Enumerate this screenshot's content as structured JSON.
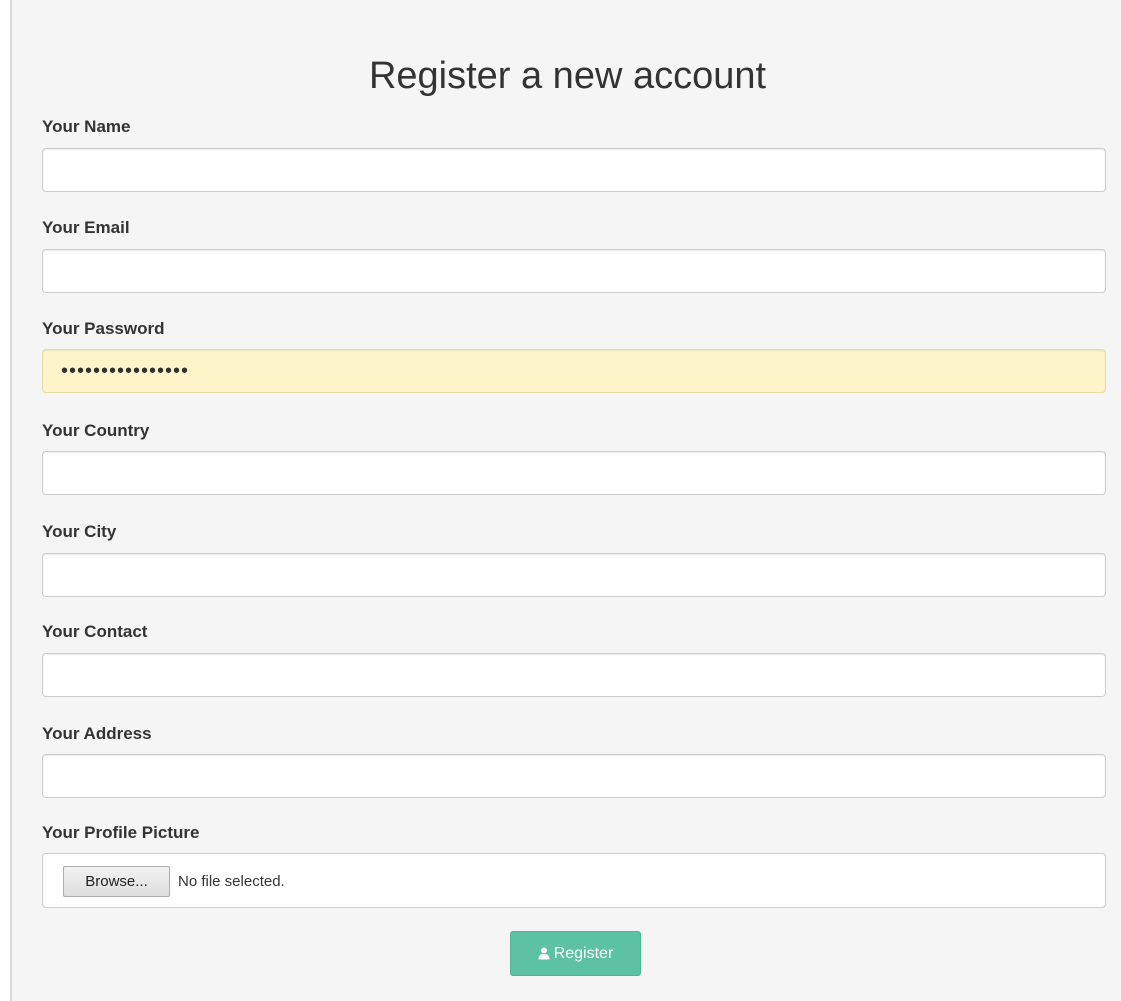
{
  "form": {
    "title": "Register a new account",
    "fields": [
      {
        "label": "Your Name",
        "value": "",
        "type": "text"
      },
      {
        "label": "Your Email",
        "value": "",
        "type": "email"
      },
      {
        "label": "Your Password",
        "value": "••••••••••••••••",
        "type": "password"
      },
      {
        "label": "Your Country",
        "value": "",
        "type": "text"
      },
      {
        "label": "Your City",
        "value": "",
        "type": "text"
      },
      {
        "label": "Your Contact",
        "value": "",
        "type": "text"
      },
      {
        "label": "Your Address",
        "value": "",
        "type": "text"
      }
    ],
    "profile_picture": {
      "label": "Your Profile Picture",
      "browse_label": "Browse...",
      "status": "No file selected."
    },
    "submit": {
      "label": "Register",
      "icon": "user-icon"
    }
  },
  "colors": {
    "page_background": "#f5f5f5",
    "autofill_background": "#fdf5c9",
    "submit_button": "#5cc2a2"
  }
}
